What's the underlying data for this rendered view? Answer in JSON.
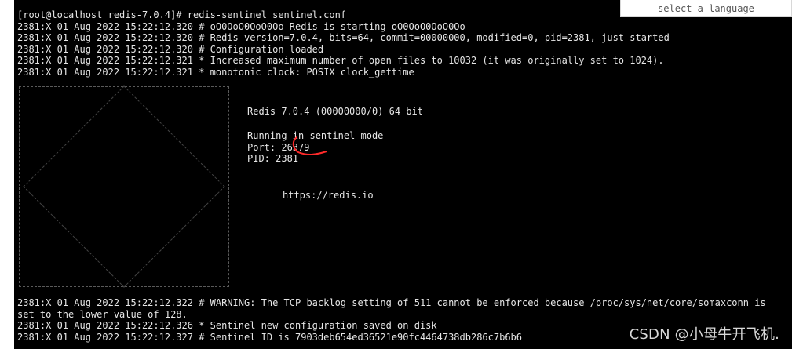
{
  "language_selector": {
    "label": "select a language"
  },
  "terminal": {
    "prompt_line": "[root@localhost redis-7.0.4]# redis-sentinel sentinel.conf",
    "log_lines_top": [
      "2381:X 01 Aug 2022 15:22:12.320 # oO0OoO0OoO0Oo Redis is starting oO0OoO0OoO0Oo",
      "2381:X 01 Aug 2022 15:22:12.320 # Redis version=7.0.4, bits=64, commit=00000000, modified=0, pid=2381, just started",
      "2381:X 01 Aug 2022 15:22:12.320 # Configuration loaded",
      "2381:X 01 Aug 2022 15:22:12.321 * Increased maximum number of open files to 10032 (it was originally set to 1024).",
      "2381:X 01 Aug 2022 15:22:12.321 * monotonic clock: POSIX clock_gettime"
    ],
    "banner": {
      "version_line": "Redis 7.0.4 (00000000/0) 64 bit",
      "mode_line": "Running in sentinel mode",
      "port_line": "Port: 26379",
      "pid_line": "PID: 2381",
      "url": "https://redis.io"
    },
    "log_lines_bottom": [
      "2381:X 01 Aug 2022 15:22:12.322 # WARNING: The TCP backlog setting of 511 cannot be enforced because /proc/sys/net/core/somaxconn is",
      "set to the lower value of 128.",
      "2381:X 01 Aug 2022 15:22:12.326 * Sentinel new configuration saved on disk",
      "2381:X 01 Aug 2022 15:22:12.327 # Sentinel ID is 7903deb654ed36521e90fc4464738db286c7b6b6"
    ]
  },
  "watermark": {
    "text": "CSDN @小母牛开飞机."
  },
  "annotation_color": "#ff2a2a"
}
